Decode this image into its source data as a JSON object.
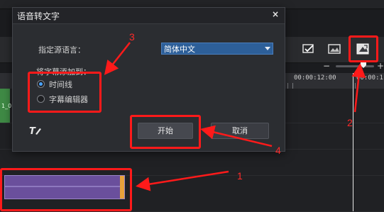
{
  "dialog": {
    "title": "语音转文字",
    "close_glyph": "×",
    "source_language_label": "指定源语言：",
    "source_language_value": "简体中文",
    "add_subtitles_label": "将字幕添加到：",
    "options": [
      {
        "label": "时间线",
        "selected": true
      },
      {
        "label": "字幕编辑器",
        "selected": false
      }
    ],
    "start_label": "开始",
    "cancel_label": "取消",
    "text_tool_icon": "text-tool-icon"
  },
  "ruler": {
    "ticks": [
      "00:00:12:00",
      "00:00:1"
    ]
  },
  "zoom": {
    "minus": "−",
    "plus": "+"
  },
  "toolbar_icons": [
    "subtitle-check-icon",
    "subtitle-image-icon",
    "speech-to-text-icon"
  ],
  "track": {
    "left_clip_label": "1_0"
  },
  "annotations": {
    "numbers": [
      "1",
      "2",
      "3",
      "4"
    ],
    "color": "#ff1a1a"
  },
  "colors": {
    "select_bg": "#2d5f99",
    "audio_clip": "#6a4f9c",
    "clip_edge": "#e9a23a",
    "radio_on": "#4aa3ff"
  }
}
